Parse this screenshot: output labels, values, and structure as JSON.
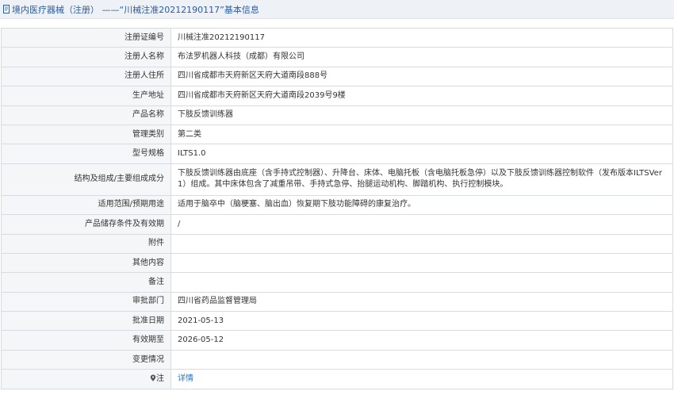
{
  "header": {
    "title": "境内医疗器械（注册） ——“川械注准20212190117”基本信息"
  },
  "rows": [
    {
      "label": "注册证编号",
      "value": "川械注准20212190117"
    },
    {
      "label": "注册人名称",
      "value": "布法罗机器人科技（成都）有限公司"
    },
    {
      "label": "注册人住所",
      "value": "四川省成都市天府新区天府大道南段888号"
    },
    {
      "label": "生产地址",
      "value": "四川省成都市天府新区天府大道南段2039号9楼"
    },
    {
      "label": "产品名称",
      "value": "下肢反馈训练器"
    },
    {
      "label": "管理类别",
      "value": "第二类"
    },
    {
      "label": "型号规格",
      "value": "ILTS1.0"
    },
    {
      "label": "结构及组成/主要组成成分",
      "value": "下肢反馈训练器由底座（含手持式控制器）、升降台、床体、电脑托板（含电脑托板急停）以及下肢反馈训练器控制软件（发布版本ILTSVer 1）组成。其中床体包含了减重吊带、手持式急停、抬腿运动机构、脚踏机构、执行控制模块。"
    },
    {
      "label": "适用范围/预期用途",
      "value": "适用于脑卒中（脑梗塞、脑出血）恢复期下肢功能障碍的康复治疗。"
    },
    {
      "label": "产品储存条件及有效期",
      "value": "/"
    },
    {
      "label": "附件",
      "value": ""
    },
    {
      "label": "其他内容",
      "value": ""
    },
    {
      "label": "备注",
      "value": ""
    },
    {
      "label": "审批部门",
      "value": "四川省药品监督管理局"
    },
    {
      "label": "批准日期",
      "value": "2021-05-13"
    },
    {
      "label": "有效期至",
      "value": "2026-05-12"
    },
    {
      "label": "变更情况",
      "value": ""
    }
  ],
  "note_row": {
    "label": "注",
    "icon": "location-pin-icon",
    "link_text": "详情"
  },
  "colors": {
    "header_bg": "#eef1f6",
    "title": "#2a5c9e",
    "link": "#2a73c4",
    "border": "#d7dce3"
  }
}
